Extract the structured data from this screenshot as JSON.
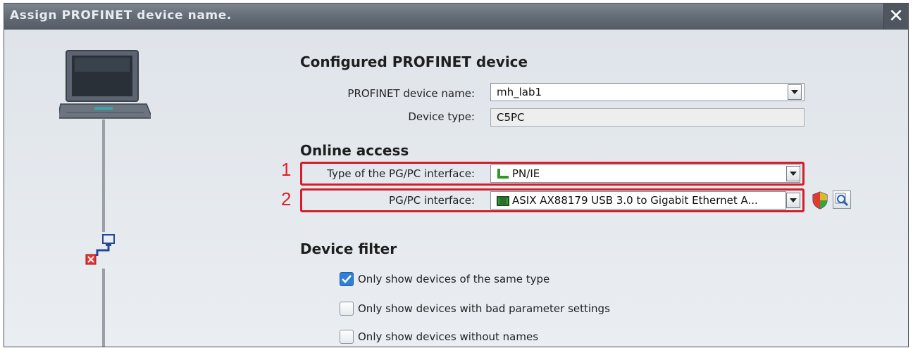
{
  "dialog": {
    "title": "Assign PROFINET device name."
  },
  "configured": {
    "heading": "Configured PROFINET device",
    "name_label": "PROFINET device name:",
    "name_value": "mh_lab1",
    "type_label": "Device type:",
    "type_value": "C5PC"
  },
  "online": {
    "heading": "Online access",
    "iface_type_label": "Type of the PG/PC interface:",
    "iface_type_value": "PN/IE",
    "iface_label": "PG/PC interface:",
    "iface_value": "ASIX AX88179 USB 3.0 to Gigabit Ethernet A...",
    "marker1": "1",
    "marker2": "2"
  },
  "filter": {
    "heading": "Device filter",
    "options": [
      {
        "label": "Only show devices of the same type",
        "checked": true
      },
      {
        "label": "Only show devices with bad parameter settings",
        "checked": false
      },
      {
        "label": "Only show devices without names",
        "checked": false
      }
    ]
  },
  "icons": [
    "close-icon",
    "laptop-icon",
    "network-node-icon",
    "error-icon",
    "pn-ie-icon",
    "network-card-icon",
    "shield-icon",
    "search-icon",
    "chevron-down-icon",
    "checkmark-icon"
  ],
  "colors": {
    "highlight": "#d21f2a",
    "checkbox": "#2f7fd8"
  }
}
